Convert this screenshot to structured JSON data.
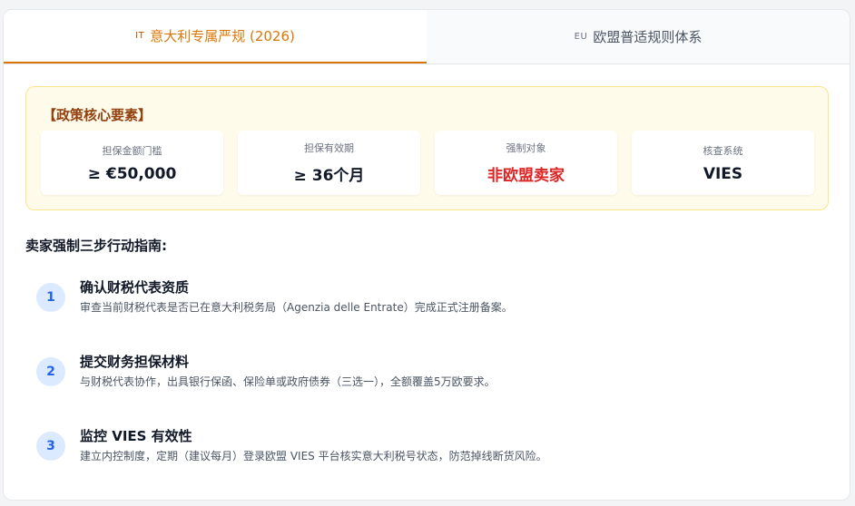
{
  "tabs": [
    {
      "flag": "IT",
      "label": "意大利专属严规 (2026)",
      "active": true
    },
    {
      "flag": "EU",
      "label": "欧盟普适规则体系",
      "active": false
    }
  ],
  "policy": {
    "title": "【政策核心要素】",
    "metrics": [
      {
        "label": "担保金额门槛",
        "value": "≥ €50,000"
      },
      {
        "label": "担保有效期",
        "value": "≥ 36个月"
      },
      {
        "label": "强制对象",
        "value": "非欧盟卖家"
      },
      {
        "label": "核查系统",
        "value": "VIES"
      }
    ]
  },
  "guide": {
    "title": "卖家强制三步行动指南:",
    "steps": [
      {
        "num": "1",
        "title": "确认财税代表资质",
        "desc": "审查当前财税代表是否已在意大利税务局（Agenzia delle Entrate）完成正式注册备案。"
      },
      {
        "num": "2",
        "title": "提交财务担保材料",
        "desc": "与财税代表协作，出具银行保函、保险单或政府债券（三选一），全额覆盖5万欧要求。"
      },
      {
        "num": "3",
        "title": "监控 VIES 有效性",
        "desc": "建立内控制度，定期（建议每月）登录欧盟 VIES 平台核实意大利税号状态，防范掉线断货风险。"
      }
    ]
  },
  "colors": {
    "accent": "#d97706",
    "alert": "#dc2626",
    "step_badge": "#2563eb"
  }
}
